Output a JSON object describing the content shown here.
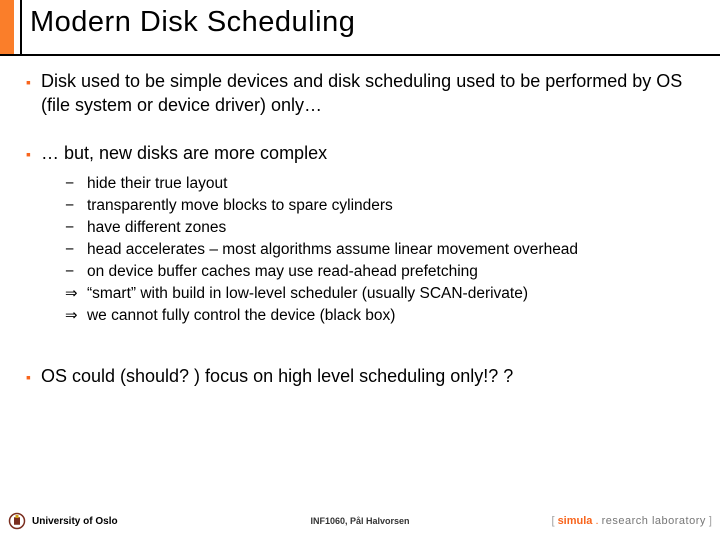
{
  "title": "Modern Disk Scheduling",
  "bullets": {
    "b1": "Disk used to be simple devices and disk scheduling used to be performed by OS (file system or device driver) only…",
    "b2": "… but, new disks are more complex",
    "b2_sub": {
      "s1": "hide their true layout",
      "s2": "transparently move blocks to spare cylinders",
      "s3": "have different zones",
      "s4": "head accelerates – most algorithms assume linear movement overhead",
      "s5": "on device buffer caches may use read-ahead prefetching",
      "a1": "“smart” with build in low-level scheduler (usually SCAN-derivate)",
      "a2": "we cannot fully control the device (black box)"
    },
    "b3": "OS could (should? ) focus on high level scheduling only!? ?"
  },
  "footer": {
    "university": "University of Oslo",
    "course": "INF1060, Pål Halvorsen",
    "lab_open": "[ ",
    "lab_sim": "simula",
    "lab_dot": " . ",
    "lab_rl": "research laboratory",
    "lab_close": " ]"
  },
  "glyphs": {
    "square": "▪",
    "dash": "−",
    "arrow": "⇒"
  }
}
